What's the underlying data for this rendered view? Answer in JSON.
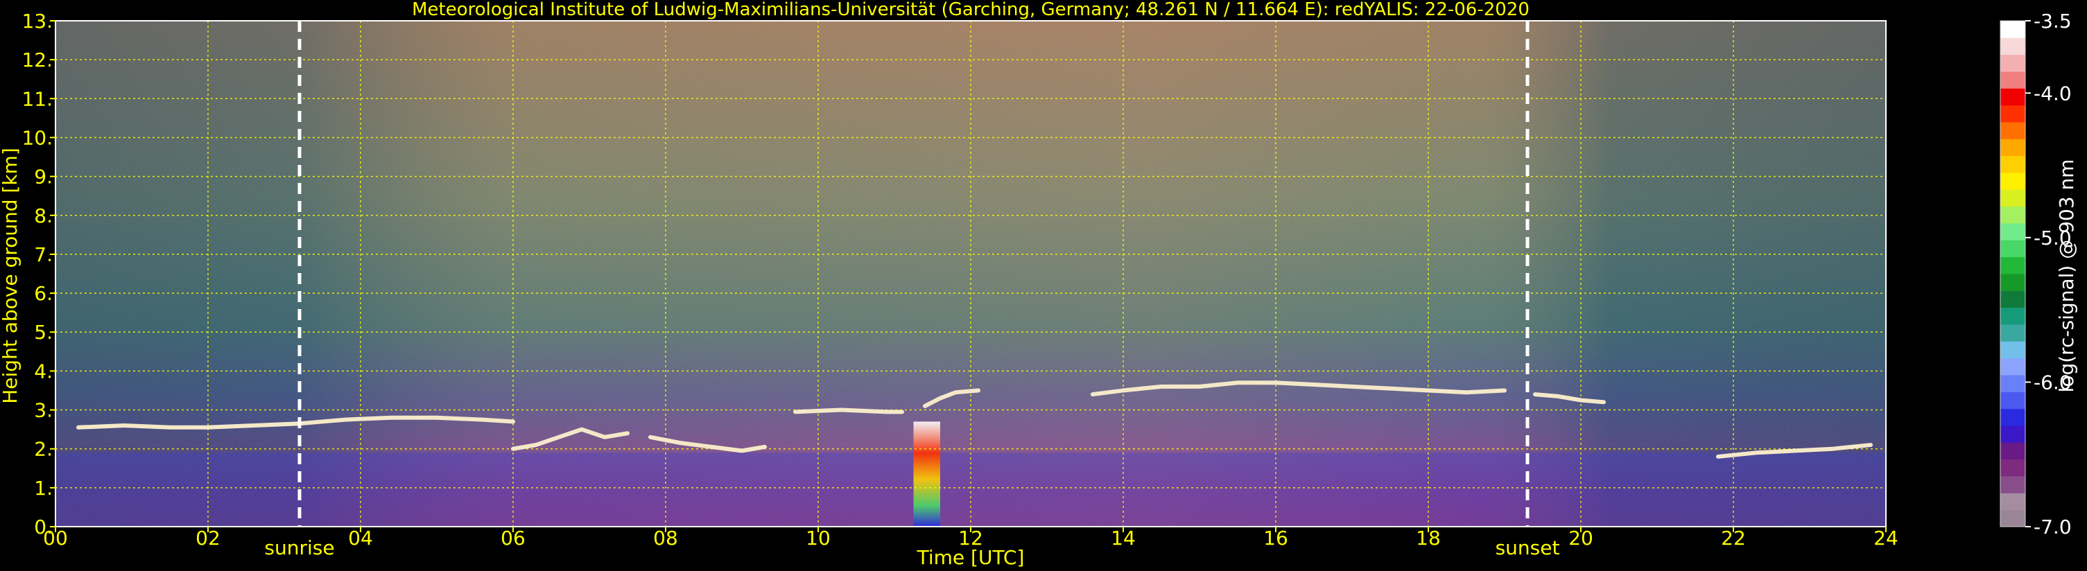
{
  "chart_data": {
    "type": "heatmap",
    "title": "Meteorological Institute of Ludwig-Maximilians-Universität (Garching, Germany; 48.261 N / 11.664 E):    redYALIS: 22-06-2020",
    "xlabel": "Time [UTC]",
    "ylabel": "Height above ground [km]",
    "xlim": [
      0,
      24
    ],
    "ylim": [
      0,
      13
    ],
    "x_ticks": [
      "00",
      "02",
      "04",
      "06",
      "08",
      "10",
      "12",
      "14",
      "16",
      "18",
      "20",
      "22",
      "24"
    ],
    "y_ticks": [
      "0.",
      "1.",
      "2.",
      "3.",
      "4.",
      "5.",
      "6.",
      "7.",
      "8.",
      "9.",
      "10.",
      "11.",
      "12.",
      "13."
    ],
    "grid": true,
    "events": [
      {
        "label": "sunrise",
        "time": 3.2
      },
      {
        "label": "sunset",
        "time": 19.3
      }
    ],
    "colorbar": {
      "label": "log(rc-signal) @ 903 nm",
      "range": [
        -7.0,
        -3.5
      ],
      "ticks": [
        {
          "value": -3.5,
          "label": "-3.5"
        },
        {
          "value": -4.0,
          "label": "-4.0"
        },
        {
          "value": -5.0,
          "label": "-5.0"
        },
        {
          "value": -6.0,
          "label": "-6.0"
        },
        {
          "value": -7.0,
          "label": "-7.0"
        }
      ],
      "colors": [
        "#9a8597",
        "#a58da1",
        "#8a4d8c",
        "#7d2a7f",
        "#6a1a86",
        "#3a18c8",
        "#2a2ae0",
        "#4a5af0",
        "#6a80f8",
        "#8aa4ff",
        "#72c0ea",
        "#3aa8a0",
        "#159a7a",
        "#0f7a3a",
        "#159a28",
        "#22b83a",
        "#48d868",
        "#72ec8a",
        "#a4f060",
        "#d8f020",
        "#fff000",
        "#ffd000",
        "#ffa800",
        "#ff7000",
        "#ff3000",
        "#f00000",
        "#f08080",
        "#f4b0b0",
        "#f8d8d8",
        "#ffffff"
      ]
    },
    "cloud_base_layers": [
      {
        "t": [
          0.3,
          0.9,
          1.5,
          2.0,
          2.6,
          3.2,
          3.8,
          4.4,
          5.0,
          5.6,
          6.0
        ],
        "h": [
          2.55,
          2.6,
          2.55,
          2.55,
          2.6,
          2.65,
          2.75,
          2.8,
          2.8,
          2.75,
          2.7
        ]
      },
      {
        "t": [
          6.0,
          6.3,
          6.6,
          6.9,
          7.2,
          7.5
        ],
        "h": [
          2.0,
          2.1,
          2.3,
          2.5,
          2.3,
          2.4
        ]
      },
      {
        "t": [
          7.8,
          8.2,
          8.6,
          9.0,
          9.3
        ],
        "h": [
          2.3,
          2.15,
          2.05,
          1.95,
          2.05
        ]
      },
      {
        "t": [
          9.7,
          10.3,
          10.9,
          11.1
        ],
        "h": [
          2.95,
          3.0,
          2.95,
          2.95
        ]
      },
      {
        "t": [
          11.4,
          11.6,
          11.8,
          12.1
        ],
        "h": [
          3.1,
          3.3,
          3.45,
          3.5
        ]
      },
      {
        "t": [
          13.6,
          14.0,
          14.5,
          15.0,
          15.5,
          16.0,
          16.5,
          17.0,
          17.5,
          18.0,
          18.5,
          19.0
        ],
        "h": [
          3.4,
          3.5,
          3.6,
          3.6,
          3.7,
          3.7,
          3.65,
          3.6,
          3.55,
          3.5,
          3.45,
          3.5
        ]
      },
      {
        "t": [
          19.4,
          19.7,
          20.0,
          20.3
        ],
        "h": [
          3.4,
          3.35,
          3.25,
          3.2
        ]
      },
      {
        "t": [
          21.8,
          22.3,
          22.8,
          23.3,
          23.8
        ],
        "h": [
          1.8,
          1.9,
          1.95,
          2.0,
          2.1
        ]
      }
    ]
  }
}
